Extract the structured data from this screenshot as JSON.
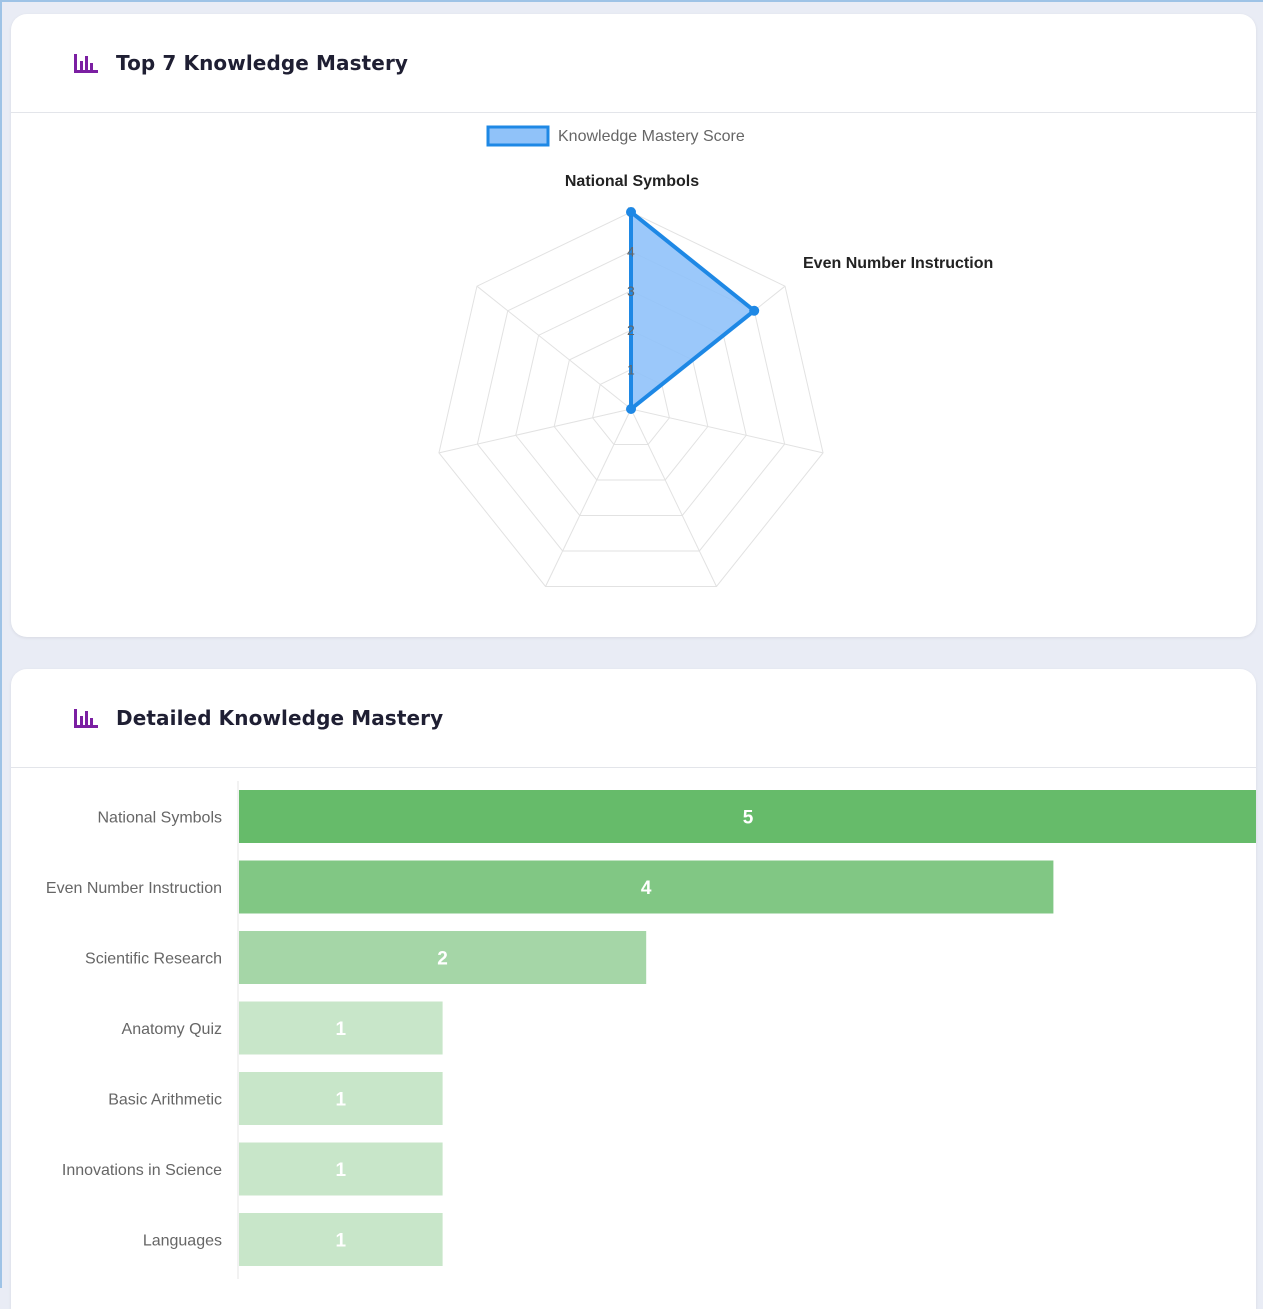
{
  "radar_card": {
    "title": "Top 7 Knowledge Mastery",
    "icon": "bar-chart-icon"
  },
  "bar_card": {
    "title": "Detailed Knowledge Mastery",
    "icon": "bar-chart-icon"
  },
  "colors": {
    "icon_purple": "#7b1fa2",
    "radar_line": "#1e88e5",
    "radar_fill": "#90c2f9",
    "bar_shades": [
      "#66bb6a",
      "#81c784",
      "#a5d6a7",
      "#c8e6c9"
    ]
  },
  "chart_data": [
    {
      "type": "radar",
      "legend": [
        "Knowledge Mastery Score"
      ],
      "axes": [
        "National Symbols",
        "Even Number Instruction",
        "",
        "",
        "",
        "",
        ""
      ],
      "series": [
        {
          "name": "Knowledge Mastery Score",
          "values": [
            5,
            4,
            0,
            0,
            0,
            0,
            0
          ]
        }
      ],
      "r_ticks": [
        "1",
        "2",
        "3",
        "4",
        "5"
      ],
      "rlim": [
        0,
        5
      ]
    },
    {
      "type": "bar",
      "orientation": "horizontal",
      "categories": [
        "National Symbols",
        "Even Number Instruction",
        "Scientific Research",
        "Anatomy Quiz",
        "Basic Arithmetic",
        "Innovations in Science",
        "Languages"
      ],
      "values": [
        5,
        4,
        2,
        1,
        1,
        1,
        1
      ],
      "xlim": [
        0,
        5
      ],
      "data_labels": [
        "5",
        "4",
        "2",
        "1",
        "1",
        "1",
        "1"
      ]
    }
  ]
}
